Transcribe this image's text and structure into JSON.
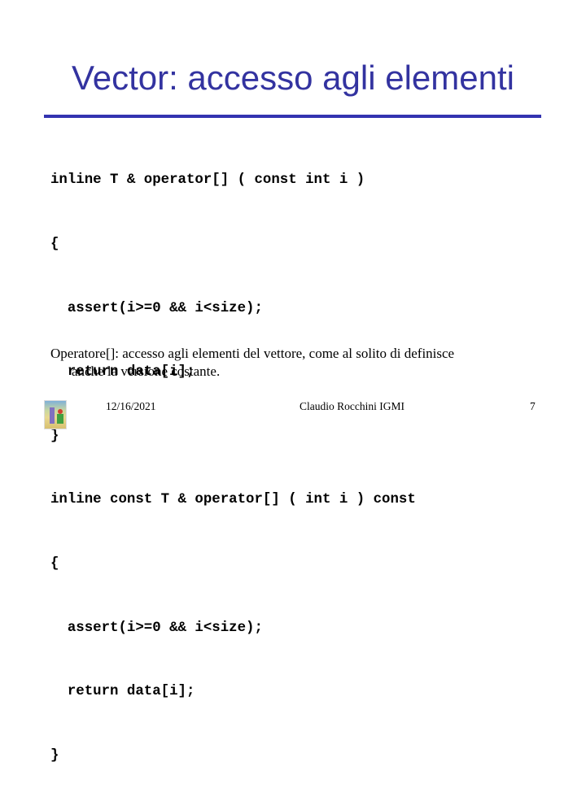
{
  "slide": {
    "title": "Vector: accesso agli elementi",
    "code_lines": [
      "inline T & operator[] ( const int i )",
      "{",
      "  assert(i>=0 && i<size);",
      "  return data[i];",
      "}",
      "inline const T & operator[] ( int i ) const",
      "{",
      "  assert(i>=0 && i<size);",
      "  return data[i];",
      "}"
    ],
    "description_line1": "Operatore[]: accesso agli elementi del vettore, come al solito di definisce",
    "description_line2": "anche la versione costante.",
    "colors": {
      "title": "#3333a0",
      "rule": "#3333b0"
    }
  },
  "footer": {
    "date": "12/16/2021",
    "author": "Claudio Rocchini IGMI",
    "page_number": "7",
    "logo_icon": "book-cover-image"
  }
}
